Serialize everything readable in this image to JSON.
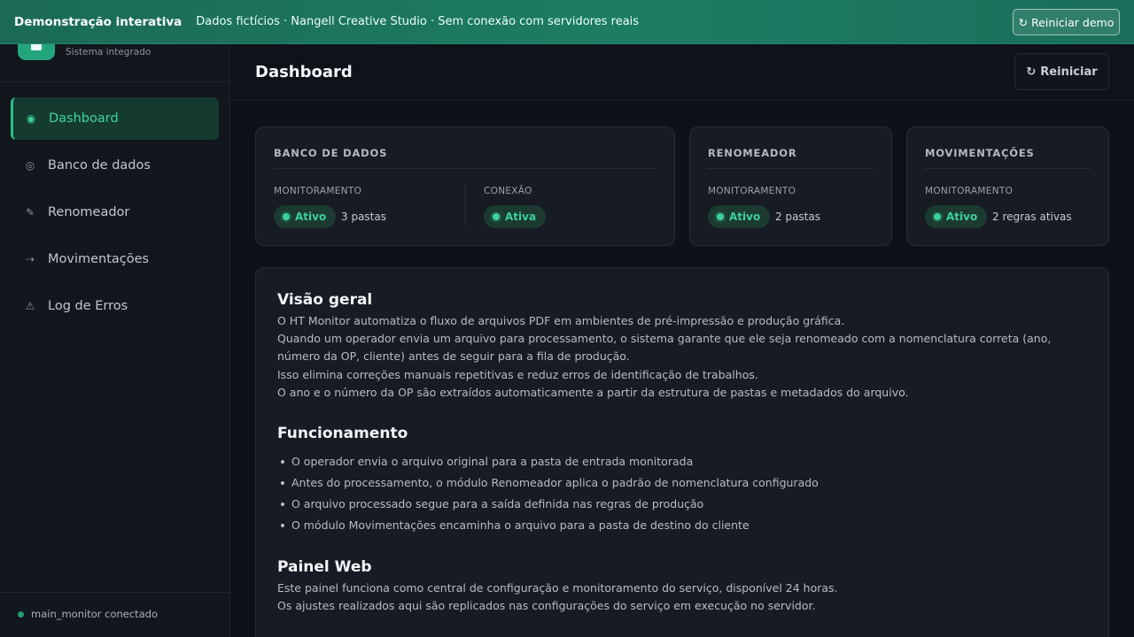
{
  "banner": {
    "title": "Demonstração interativa",
    "text": "Dados fictícios · Nangell Creative Studio · Sem conexão com servidores reais",
    "reset_label": "Reiniciar demo",
    "reset_icon": "↻"
  },
  "sidebar": {
    "subtitle": "Sistema integrado",
    "items": [
      {
        "label": "Dashboard",
        "icon": "◉"
      },
      {
        "label": "Banco de dados",
        "icon": "◎"
      },
      {
        "label": "Renomeador",
        "icon": "✎"
      },
      {
        "label": "Movimentações",
        "icon": "⇢"
      },
      {
        "label": "Log de Erros",
        "icon": "⚠"
      }
    ],
    "status": "main_monitor conectado"
  },
  "header": {
    "title": "Dashboard",
    "reset_label": "Reiniciar",
    "reset_icon": "↻"
  },
  "cards": {
    "db": {
      "title": "BANCO DE DADOS",
      "mon_label": "MONITORAMENTO",
      "mon_status": "Ativo",
      "mon_value": "3 pastas",
      "conn_label": "CONEXÃO",
      "conn_status": "Ativa"
    },
    "ren": {
      "title": "RENOMEADOR",
      "mon_label": "MONITORAMENTO",
      "mon_status": "Ativo",
      "mon_value": "2 pastas"
    },
    "mov": {
      "title": "MOVIMENTAÇÕES",
      "mon_label": "MONITORAMENTO",
      "mon_status": "Ativo",
      "mon_value": "2 regras ativas"
    }
  },
  "overview": {
    "h1": "Visão geral",
    "p1": [
      "O HT Monitor automatiza o fluxo de arquivos PDF em ambientes de pré-impressão e produção gráfica.",
      "Quando um operador envia um arquivo para processamento, o sistema garante que ele seja renomeado com a nomenclatura correta (ano, número da OP, cliente) antes de seguir para a fila de produção.",
      "Isso elimina correções manuais repetitivas e reduz erros de identificação de trabalhos.",
      "O ano e o número da OP são extraídos automaticamente a partir da estrutura de pastas e metadados do arquivo."
    ],
    "h2": "Funcionamento",
    "list": [
      "O operador envia o arquivo original para a pasta de entrada monitorada",
      "Antes do processamento, o módulo Renomeador aplica o padrão de nomenclatura configurado",
      "O arquivo processado segue para a saída definida nas regras de produção",
      "O módulo Movimentações encaminha o arquivo para a pasta de destino do cliente"
    ],
    "h3": "Painel Web",
    "p3": [
      "Este painel funciona como central de configuração e monitoramento do serviço, disponível 24 horas.",
      "Os ajustes realizados aqui são replicados nas configurações do serviço em execução no servidor."
    ]
  }
}
